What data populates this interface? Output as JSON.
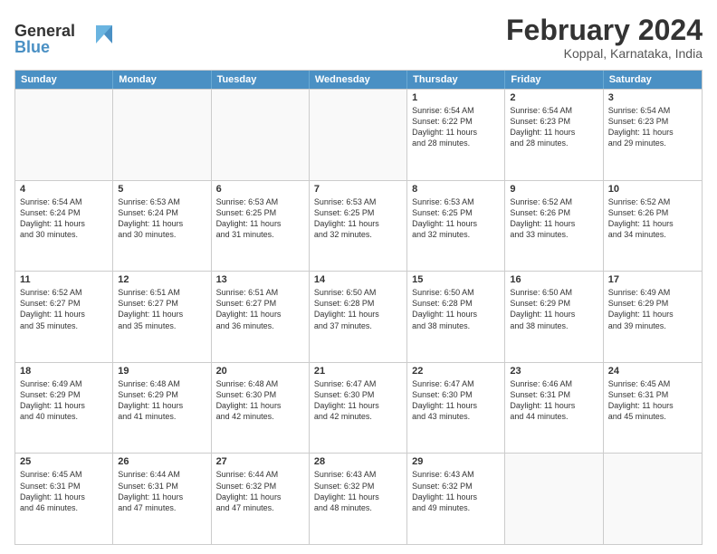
{
  "header": {
    "logo_line1": "General",
    "logo_line2": "Blue",
    "month_year": "February 2024",
    "location": "Koppal, Karnataka, India"
  },
  "weekdays": [
    "Sunday",
    "Monday",
    "Tuesday",
    "Wednesday",
    "Thursday",
    "Friday",
    "Saturday"
  ],
  "weeks": [
    [
      {
        "day": "",
        "info": ""
      },
      {
        "day": "",
        "info": ""
      },
      {
        "day": "",
        "info": ""
      },
      {
        "day": "",
        "info": ""
      },
      {
        "day": "1",
        "info": "Sunrise: 6:54 AM\nSunset: 6:22 PM\nDaylight: 11 hours\nand 28 minutes."
      },
      {
        "day": "2",
        "info": "Sunrise: 6:54 AM\nSunset: 6:23 PM\nDaylight: 11 hours\nand 28 minutes."
      },
      {
        "day": "3",
        "info": "Sunrise: 6:54 AM\nSunset: 6:23 PM\nDaylight: 11 hours\nand 29 minutes."
      }
    ],
    [
      {
        "day": "4",
        "info": "Sunrise: 6:54 AM\nSunset: 6:24 PM\nDaylight: 11 hours\nand 30 minutes."
      },
      {
        "day": "5",
        "info": "Sunrise: 6:53 AM\nSunset: 6:24 PM\nDaylight: 11 hours\nand 30 minutes."
      },
      {
        "day": "6",
        "info": "Sunrise: 6:53 AM\nSunset: 6:25 PM\nDaylight: 11 hours\nand 31 minutes."
      },
      {
        "day": "7",
        "info": "Sunrise: 6:53 AM\nSunset: 6:25 PM\nDaylight: 11 hours\nand 32 minutes."
      },
      {
        "day": "8",
        "info": "Sunrise: 6:53 AM\nSunset: 6:25 PM\nDaylight: 11 hours\nand 32 minutes."
      },
      {
        "day": "9",
        "info": "Sunrise: 6:52 AM\nSunset: 6:26 PM\nDaylight: 11 hours\nand 33 minutes."
      },
      {
        "day": "10",
        "info": "Sunrise: 6:52 AM\nSunset: 6:26 PM\nDaylight: 11 hours\nand 34 minutes."
      }
    ],
    [
      {
        "day": "11",
        "info": "Sunrise: 6:52 AM\nSunset: 6:27 PM\nDaylight: 11 hours\nand 35 minutes."
      },
      {
        "day": "12",
        "info": "Sunrise: 6:51 AM\nSunset: 6:27 PM\nDaylight: 11 hours\nand 35 minutes."
      },
      {
        "day": "13",
        "info": "Sunrise: 6:51 AM\nSunset: 6:27 PM\nDaylight: 11 hours\nand 36 minutes."
      },
      {
        "day": "14",
        "info": "Sunrise: 6:50 AM\nSunset: 6:28 PM\nDaylight: 11 hours\nand 37 minutes."
      },
      {
        "day": "15",
        "info": "Sunrise: 6:50 AM\nSunset: 6:28 PM\nDaylight: 11 hours\nand 38 minutes."
      },
      {
        "day": "16",
        "info": "Sunrise: 6:50 AM\nSunset: 6:29 PM\nDaylight: 11 hours\nand 38 minutes."
      },
      {
        "day": "17",
        "info": "Sunrise: 6:49 AM\nSunset: 6:29 PM\nDaylight: 11 hours\nand 39 minutes."
      }
    ],
    [
      {
        "day": "18",
        "info": "Sunrise: 6:49 AM\nSunset: 6:29 PM\nDaylight: 11 hours\nand 40 minutes."
      },
      {
        "day": "19",
        "info": "Sunrise: 6:48 AM\nSunset: 6:29 PM\nDaylight: 11 hours\nand 41 minutes."
      },
      {
        "day": "20",
        "info": "Sunrise: 6:48 AM\nSunset: 6:30 PM\nDaylight: 11 hours\nand 42 minutes."
      },
      {
        "day": "21",
        "info": "Sunrise: 6:47 AM\nSunset: 6:30 PM\nDaylight: 11 hours\nand 42 minutes."
      },
      {
        "day": "22",
        "info": "Sunrise: 6:47 AM\nSunset: 6:30 PM\nDaylight: 11 hours\nand 43 minutes."
      },
      {
        "day": "23",
        "info": "Sunrise: 6:46 AM\nSunset: 6:31 PM\nDaylight: 11 hours\nand 44 minutes."
      },
      {
        "day": "24",
        "info": "Sunrise: 6:45 AM\nSunset: 6:31 PM\nDaylight: 11 hours\nand 45 minutes."
      }
    ],
    [
      {
        "day": "25",
        "info": "Sunrise: 6:45 AM\nSunset: 6:31 PM\nDaylight: 11 hours\nand 46 minutes."
      },
      {
        "day": "26",
        "info": "Sunrise: 6:44 AM\nSunset: 6:31 PM\nDaylight: 11 hours\nand 47 minutes."
      },
      {
        "day": "27",
        "info": "Sunrise: 6:44 AM\nSunset: 6:32 PM\nDaylight: 11 hours\nand 47 minutes."
      },
      {
        "day": "28",
        "info": "Sunrise: 6:43 AM\nSunset: 6:32 PM\nDaylight: 11 hours\nand 48 minutes."
      },
      {
        "day": "29",
        "info": "Sunrise: 6:43 AM\nSunset: 6:32 PM\nDaylight: 11 hours\nand 49 minutes."
      },
      {
        "day": "",
        "info": ""
      },
      {
        "day": "",
        "info": ""
      }
    ]
  ]
}
